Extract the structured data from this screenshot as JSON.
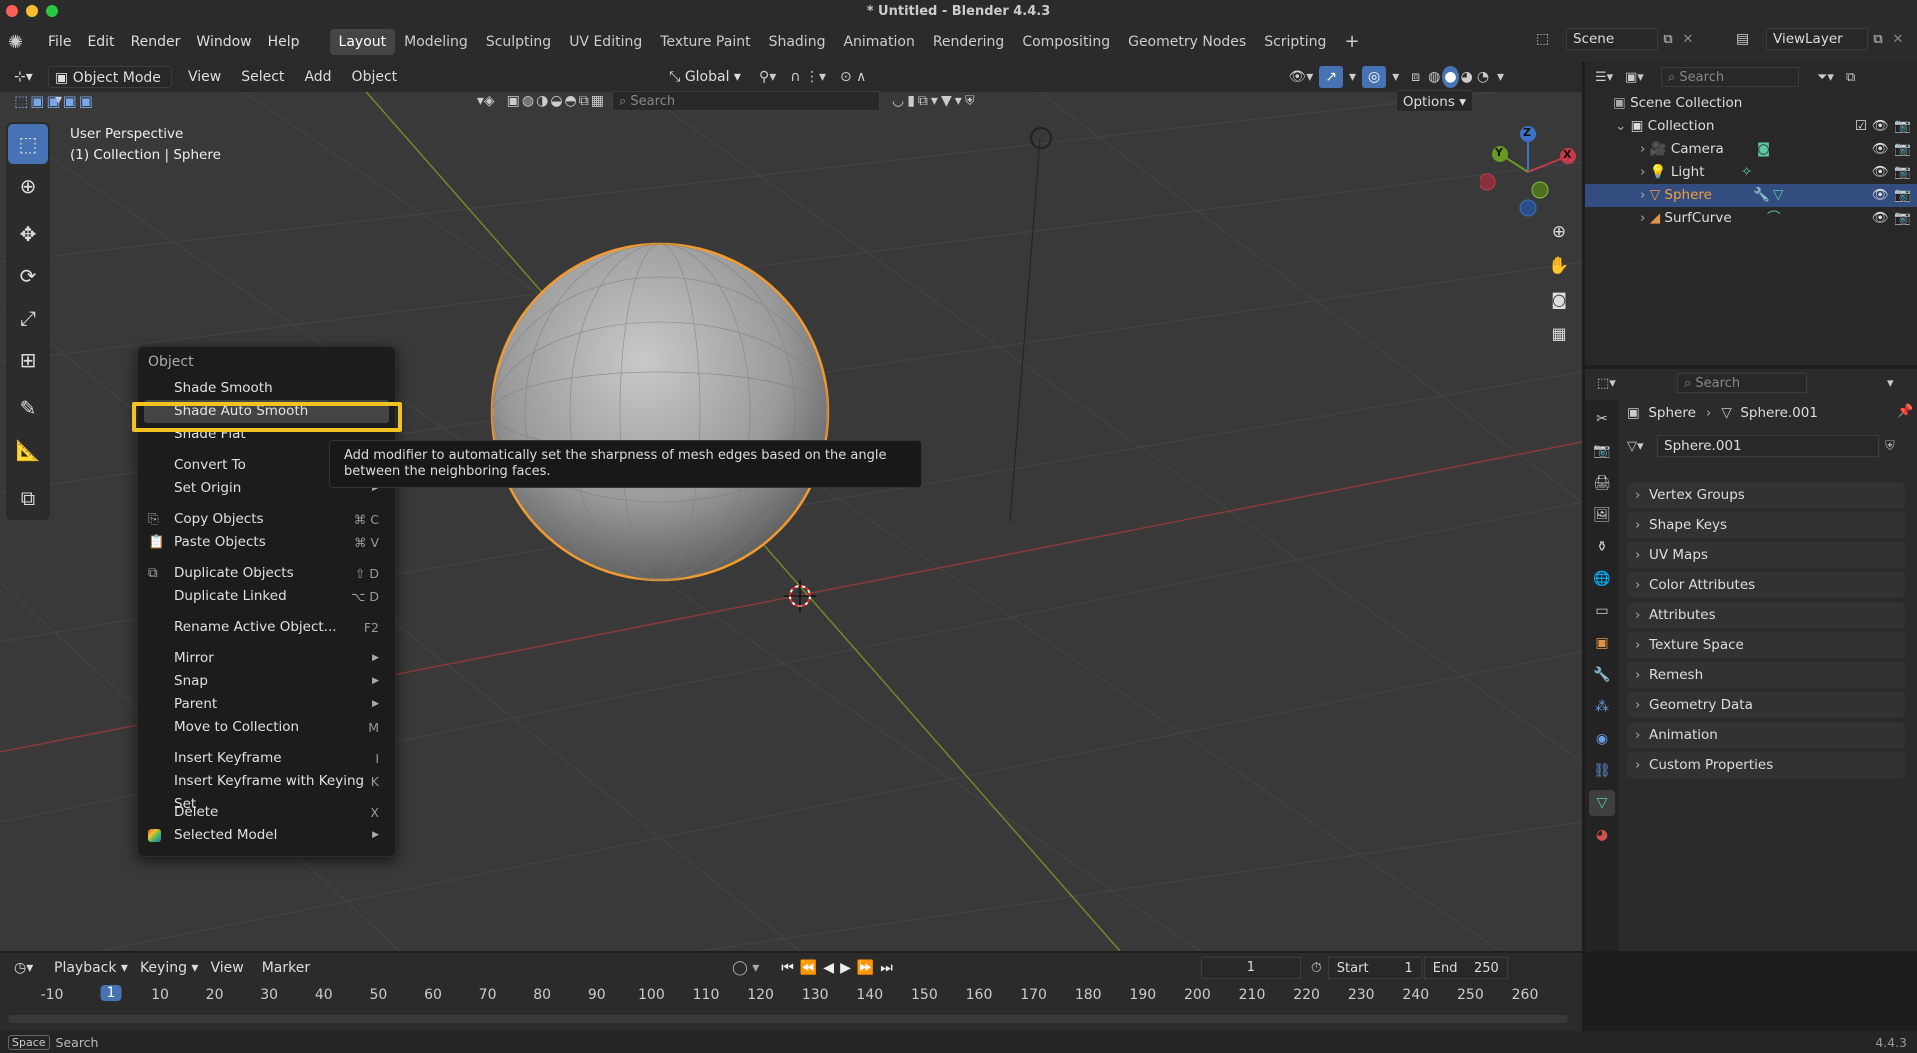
{
  "window": {
    "title": "* Untitled - Blender 4.4.3"
  },
  "menu": [
    "File",
    "Edit",
    "Render",
    "Window",
    "Help"
  ],
  "workspaces": [
    "Layout",
    "Modeling",
    "Sculpting",
    "UV Editing",
    "Texture Paint",
    "Shading",
    "Animation",
    "Rendering",
    "Compositing",
    "Geometry Nodes",
    "Scripting"
  ],
  "scene": {
    "name": "Scene",
    "view_layer": "ViewLayer"
  },
  "viewport": {
    "mode": "Object Mode",
    "menus": [
      "View",
      "Select",
      "Add",
      "Object"
    ],
    "transform": "Global",
    "search_placeholder": "Search",
    "options": "Options",
    "perspective": "User Perspective",
    "collection_info": "(1) Collection | Sphere",
    "gizmo": {
      "z": "Z",
      "y": "Y",
      "x": "X"
    }
  },
  "context_menu": {
    "title": "Object",
    "items": [
      {
        "label": "Shade Smooth",
        "shortcut": ""
      },
      {
        "label": "Shade Auto Smooth",
        "shortcut": ""
      },
      {
        "label": "Shade Flat",
        "shortcut": ""
      },
      {
        "label": "Convert To",
        "shortcut": ""
      },
      {
        "label": "Set Origin",
        "shortcut": ""
      },
      {
        "label": "Copy Objects",
        "shortcut": "⌘ C"
      },
      {
        "label": "Paste Objects",
        "shortcut": "⌘ V"
      },
      {
        "label": "Duplicate Objects",
        "shortcut": "⇧ D"
      },
      {
        "label": "Duplicate Linked",
        "shortcut": "⌥ D"
      },
      {
        "label": "Rename Active Object...",
        "shortcut": "F2"
      },
      {
        "label": "Mirror",
        "shortcut": ""
      },
      {
        "label": "Snap",
        "shortcut": ""
      },
      {
        "label": "Parent",
        "shortcut": ""
      },
      {
        "label": "Move to Collection",
        "shortcut": "M"
      },
      {
        "label": "Insert Keyframe",
        "shortcut": "I"
      },
      {
        "label": "Insert Keyframe with Keying Set",
        "shortcut": "K"
      },
      {
        "label": "Delete",
        "shortcut": "X"
      },
      {
        "label": "Selected Model",
        "shortcut": ""
      }
    ],
    "tooltip": "Add modifier to automatically set the sharpness of mesh edges based on the angle between the neighboring faces."
  },
  "outliner": {
    "search_placeholder": "Search",
    "scene_collection": "Scene Collection",
    "collection": "Collection",
    "objects": [
      "Camera",
      "Light",
      "Sphere",
      "SurfCurve"
    ]
  },
  "properties": {
    "search_placeholder": "Search",
    "breadcrumb_object": "Sphere",
    "breadcrumb_data": "Sphere.001",
    "mesh_name": "Sphere.001",
    "panels": [
      "Vertex Groups",
      "Shape Keys",
      "UV Maps",
      "Color Attributes",
      "Attributes",
      "Texture Space",
      "Remesh",
      "Geometry Data",
      "Animation",
      "Custom Properties"
    ]
  },
  "timeline": {
    "menus": [
      "Playback",
      "Keying",
      "View",
      "Marker"
    ],
    "current_frame": "1",
    "start_label": "Start",
    "start": "1",
    "end_label": "End",
    "end": "250",
    "ticks": [
      "-10",
      "1",
      "10",
      "20",
      "30",
      "40",
      "50",
      "60",
      "70",
      "80",
      "90",
      "100",
      "110",
      "120",
      "130",
      "140",
      "150",
      "160",
      "170",
      "180",
      "190",
      "200",
      "210",
      "220",
      "230",
      "240",
      "250",
      "260"
    ]
  },
  "status": {
    "key": "Space",
    "action": "Search",
    "version": "4.4.3"
  }
}
